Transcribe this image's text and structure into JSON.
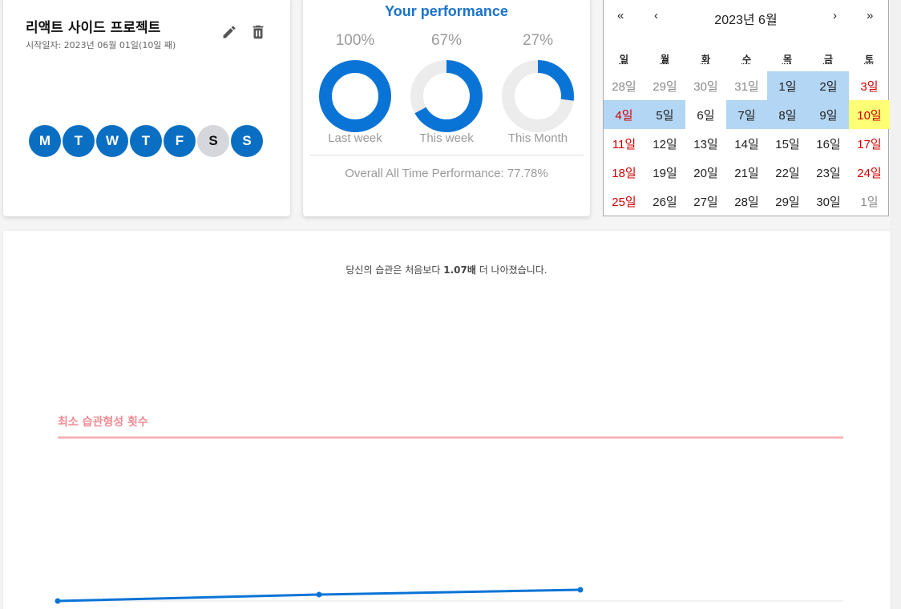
{
  "project": {
    "title": "리액트 사이드 프로젝트",
    "start_date": "시작일자: 2023년 06월 01일(10일 째)",
    "days": [
      {
        "label": "M",
        "active": true
      },
      {
        "label": "T",
        "active": true
      },
      {
        "label": "W",
        "active": true
      },
      {
        "label": "T",
        "active": true
      },
      {
        "label": "F",
        "active": true
      },
      {
        "label": "S",
        "active": false
      },
      {
        "label": "S",
        "active": true
      }
    ],
    "icons": {
      "edit": "pencil-icon",
      "delete": "trash-icon"
    }
  },
  "performance": {
    "title": "Your performance",
    "items": [
      {
        "label": "Last week",
        "percent_text": "100%",
        "value": 100
      },
      {
        "label": "This week",
        "percent_text": "67%",
        "value": 67
      },
      {
        "label": "This Month",
        "percent_text": "27%",
        "value": 27
      }
    ],
    "overall": "Overall All Time Performance: 77.78%",
    "colors": {
      "fill": "#0a74d6",
      "track": "#ececec"
    }
  },
  "calendar": {
    "prev_year": "«",
    "prev_month": "‹",
    "title": "2023년 6월",
    "next_month": "›",
    "next_year": "»",
    "weekdays": [
      "일",
      "월",
      "화",
      "수",
      "목",
      "금",
      "토"
    ],
    "cells": [
      {
        "t": "28일",
        "cls": "out"
      },
      {
        "t": "29일",
        "cls": "out"
      },
      {
        "t": "30일",
        "cls": "out"
      },
      {
        "t": "31일",
        "cls": "out"
      },
      {
        "t": "1일",
        "cls": "sel"
      },
      {
        "t": "2일",
        "cls": "sel"
      },
      {
        "t": "3일",
        "cls": "red"
      },
      {
        "t": "4일",
        "cls": "red sel"
      },
      {
        "t": "5일",
        "cls": "sel"
      },
      {
        "t": "6일",
        "cls": ""
      },
      {
        "t": "7일",
        "cls": "sel"
      },
      {
        "t": "8일",
        "cls": "sel"
      },
      {
        "t": "9일",
        "cls": "sel"
      },
      {
        "t": "10일",
        "cls": "red today"
      },
      {
        "t": "11일",
        "cls": "red"
      },
      {
        "t": "12일",
        "cls": ""
      },
      {
        "t": "13일",
        "cls": ""
      },
      {
        "t": "14일",
        "cls": ""
      },
      {
        "t": "15일",
        "cls": ""
      },
      {
        "t": "16일",
        "cls": ""
      },
      {
        "t": "17일",
        "cls": "red"
      },
      {
        "t": "18일",
        "cls": "red"
      },
      {
        "t": "19일",
        "cls": ""
      },
      {
        "t": "20일",
        "cls": ""
      },
      {
        "t": "21일",
        "cls": ""
      },
      {
        "t": "22일",
        "cls": ""
      },
      {
        "t": "23일",
        "cls": ""
      },
      {
        "t": "24일",
        "cls": "red"
      },
      {
        "t": "25일",
        "cls": "red"
      },
      {
        "t": "26일",
        "cls": ""
      },
      {
        "t": "27일",
        "cls": ""
      },
      {
        "t": "28일",
        "cls": ""
      },
      {
        "t": "29일",
        "cls": ""
      },
      {
        "t": "30일",
        "cls": ""
      },
      {
        "t": "1일",
        "cls": "out"
      }
    ]
  },
  "chart_caption": {
    "prefix": "당신의 습관은 처음보다 ",
    "highlight": "1.07배",
    "suffix": " 더 나아졌습니다."
  },
  "chart_data": {
    "type": "line",
    "threshold_label": "최소 습관형성 횟수",
    "threshold_color": "#f7b3b8",
    "line_color": "#0a74d6",
    "values": [
      1.0,
      1.04,
      1.07
    ]
  }
}
